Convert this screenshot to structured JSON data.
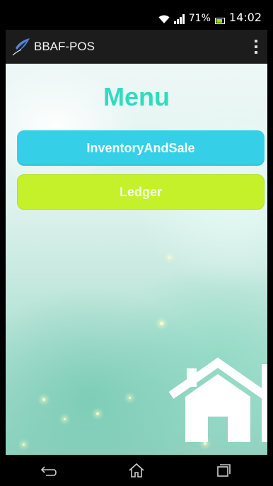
{
  "status_bar": {
    "battery_percent": "71%",
    "battery_level": 0.71,
    "time": "14:02",
    "icons": [
      "wifi-icon",
      "signal-icon",
      "battery-icon"
    ]
  },
  "action_bar": {
    "app_icon": "feather-logo-icon",
    "title": "BBAF-POS",
    "overflow_icon": "overflow-menu-icon"
  },
  "main": {
    "title": "Menu",
    "buttons": [
      {
        "label": "InventoryAndSale",
        "color": "#35cfe8"
      },
      {
        "label": "Ledger",
        "color": "#c5f12b"
      }
    ],
    "home_icon": "home-icon"
  },
  "nav_bar": {
    "buttons": [
      "back-icon",
      "home-nav-icon",
      "recent-apps-icon"
    ]
  },
  "colors": {
    "title": "#31dbc0",
    "action_bar": "#1c1c1c"
  }
}
